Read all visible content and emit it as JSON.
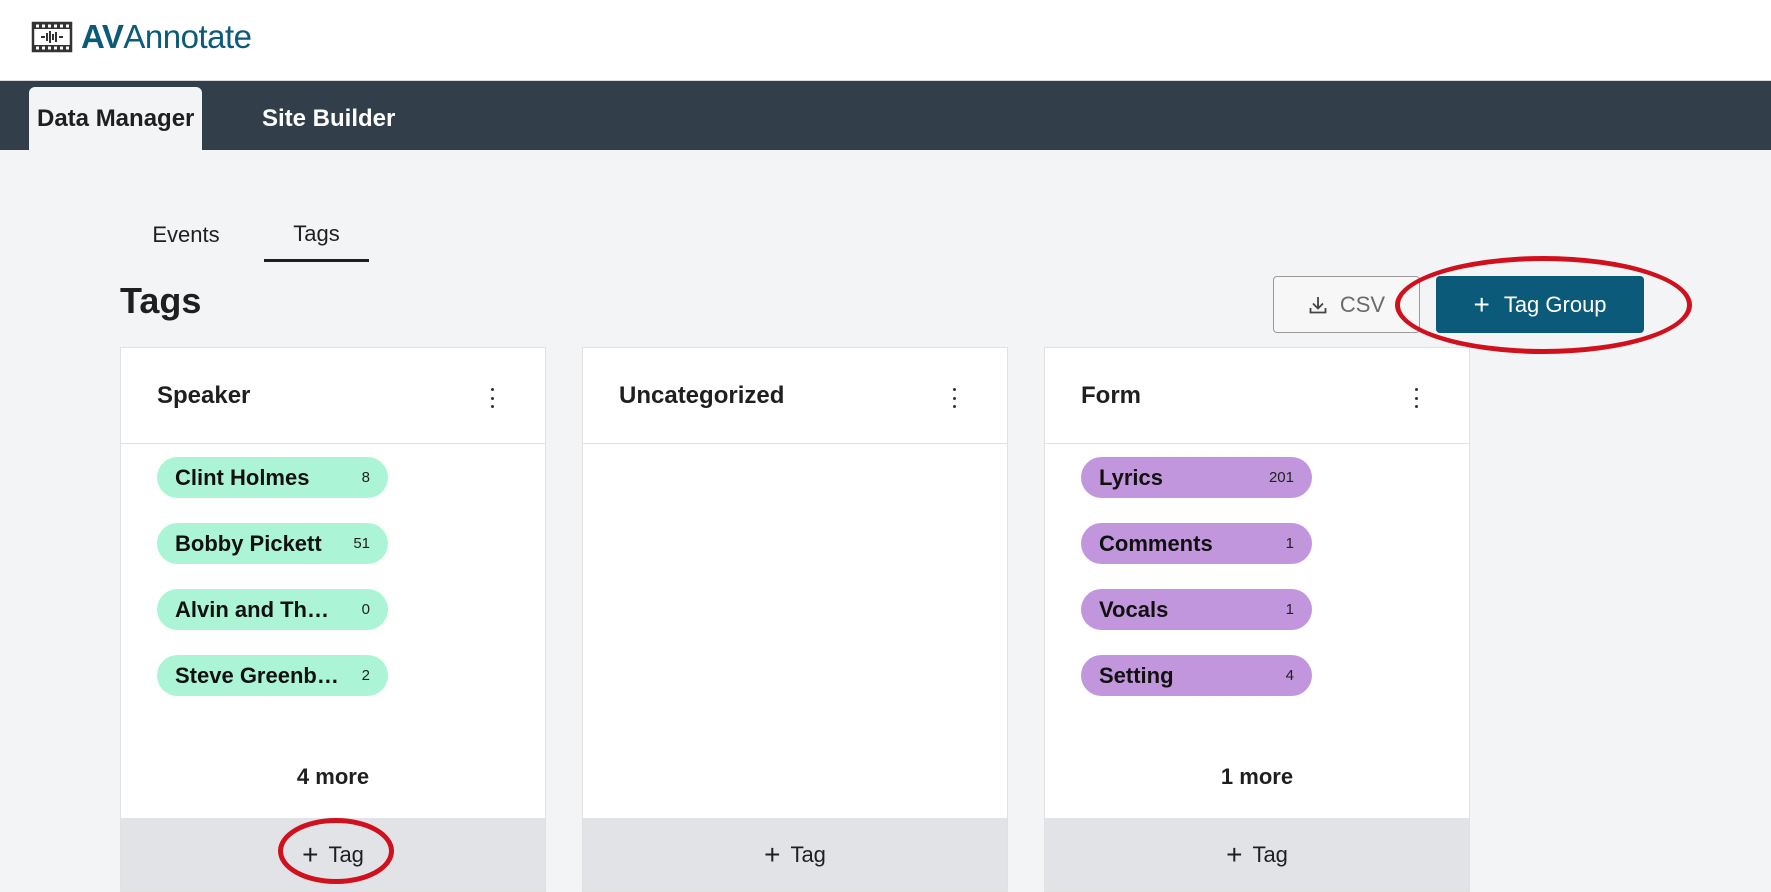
{
  "app": {
    "logo_strong": "AV",
    "logo_rest": "Annotate"
  },
  "nav": {
    "tabs": [
      {
        "label": "Data Manager"
      },
      {
        "label": "Site Builder"
      }
    ]
  },
  "subtabs": [
    {
      "label": "Events"
    },
    {
      "label": "Tags"
    }
  ],
  "page": {
    "title": "Tags"
  },
  "toolbar": {
    "csv_label": "CSV",
    "add_group_label": "Tag Group"
  },
  "groups": [
    {
      "title": "Speaker",
      "color": "#abf5d6",
      "tags": [
        {
          "name": "Clint Holmes",
          "count": "8"
        },
        {
          "name": "Bobby Pickett",
          "count": "51"
        },
        {
          "name": "Alvin and Theodore",
          "count": "0"
        },
        {
          "name": "Steve Greenberg",
          "count": "2"
        }
      ],
      "more": "4 more",
      "add_label": "Tag"
    },
    {
      "title": "Uncategorized",
      "tags": [],
      "more": "",
      "add_label": "Tag"
    },
    {
      "title": "Form",
      "color": "#c296dd",
      "tags": [
        {
          "name": "Lyrics",
          "count": "201"
        },
        {
          "name": "Comments",
          "count": "1"
        },
        {
          "name": "Vocals",
          "count": "1"
        },
        {
          "name": "Setting",
          "count": "4"
        }
      ],
      "more": "1 more",
      "add_label": "Tag"
    }
  ],
  "colors": {
    "primary": "#0b5a7a",
    "navbar": "#323f4b",
    "annotation": "#d0101c"
  }
}
